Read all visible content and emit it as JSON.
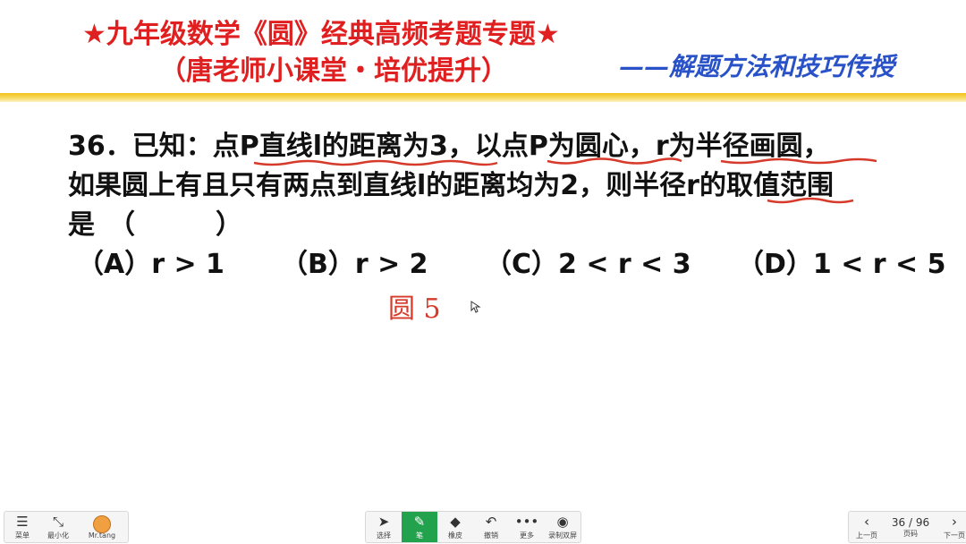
{
  "header": {
    "title": "★九年级数学《圆》经典高频考题专题★",
    "subtitle": "（唐老师小课堂・培优提升）",
    "right_text": "——解题方法和技巧传授"
  },
  "question": {
    "line1": "36．已知：点P直线l的距离为3，以点P为圆心，r为半径画圆，",
    "line2": "如果圆上有且只有两点到直线l的距离均为2，则半径r的取值范围",
    "line3": "是　（　　　）"
  },
  "options": {
    "a": "（A）r > 1",
    "b": "（B）r > 2",
    "c": "（C）2 < r < 3",
    "d": "（D）1 < r < 5"
  },
  "handwriting": "圆 5",
  "toolbar": {
    "menu": "菜单",
    "minimize": "最小化",
    "user": "Mr.tang",
    "select": "选择",
    "pen": "笔",
    "eraser": "橡皮",
    "undo": "撤销",
    "more": "更多",
    "record": "录制双屏",
    "prev": "上一页",
    "page": "36 / 96",
    "page_label": "页码",
    "next": "下一页"
  },
  "colors": {
    "title_red": "#e02020",
    "subtitle_blue": "#2a52c8",
    "ink_red": "#d63a2a",
    "pen_green": "#23a24d"
  }
}
